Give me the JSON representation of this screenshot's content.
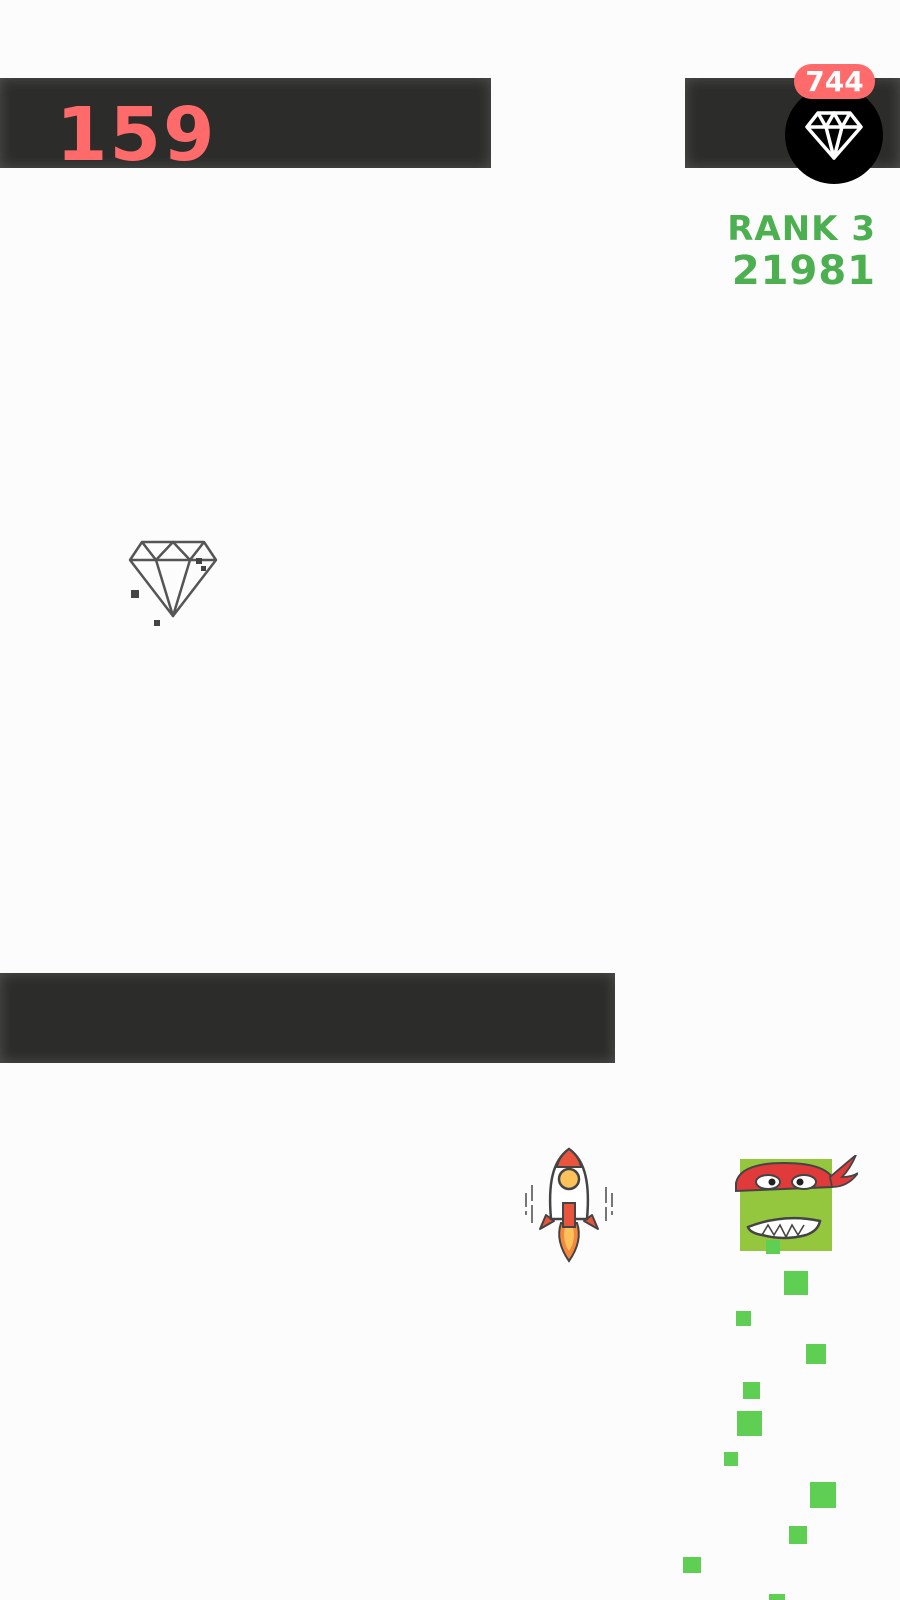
{
  "hud": {
    "score": "159",
    "gem_count": "744",
    "rank_label": "RANK 3",
    "rank_score": "21981"
  },
  "icons": {
    "gem_counter": "diamond-icon",
    "pickup": "diamond-icon",
    "vehicle": "rocket-icon",
    "player": "ninja-turtle-icon"
  },
  "colors": {
    "score": "#ff6b6b",
    "badge": "#ff6b6b",
    "rank": "#4caf50",
    "bar": "#2c2c2a",
    "trail": "#5ecf52"
  }
}
